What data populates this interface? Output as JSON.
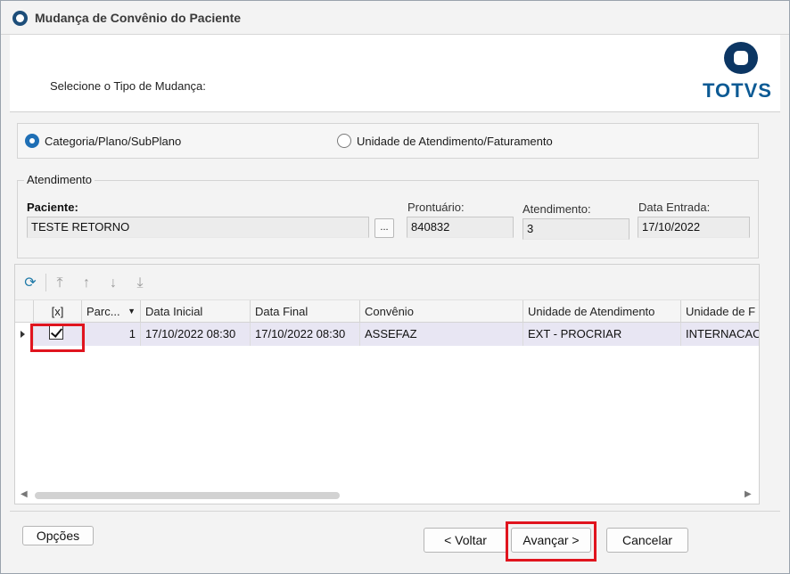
{
  "window": {
    "title": "Mudança de Convênio do Paciente"
  },
  "header": {
    "prompt": "Selecione o Tipo de Mudança:",
    "logo_text": "TOTVS"
  },
  "change_type": {
    "options": [
      {
        "label": "Categoria/Plano/SubPlano",
        "selected": true
      },
      {
        "label": "Unidade de Atendimento/Faturamento",
        "selected": false
      }
    ]
  },
  "atendimento": {
    "legend": "Atendimento",
    "paciente_label": "Paciente:",
    "paciente_value": "TESTE RETORNO",
    "lookup_button": "...",
    "prontuario_label": "Prontuário:",
    "prontuario_value": "840832",
    "atendimento_label": "Atendimento:",
    "atendimento_value": "3",
    "data_entrada_label": "Data Entrada:",
    "data_entrada_value": "17/10/2022"
  },
  "grid": {
    "columns": [
      "[x]",
      "Parc...",
      "Data Inicial",
      "Data Final",
      "Convênio",
      "Unidade de Atendimento",
      "Unidade de F"
    ],
    "rows": [
      {
        "checked": true,
        "parcela": "1",
        "data_inicial": "17/10/2022 08:30",
        "data_final": "17/10/2022 08:30",
        "convenio": "ASSEFAZ",
        "unidade_atendimento": "EXT - PROCRIAR",
        "unidade_faturamento": "INTERNACAC"
      }
    ]
  },
  "footer": {
    "options_button": "Opções",
    "back_button": "< Voltar",
    "next_button": "Avançar >",
    "cancel_button": "Cancelar"
  },
  "colors": {
    "highlight": "#e0141e",
    "accent": "#1f6fb5",
    "brand": "#0c5a94"
  }
}
